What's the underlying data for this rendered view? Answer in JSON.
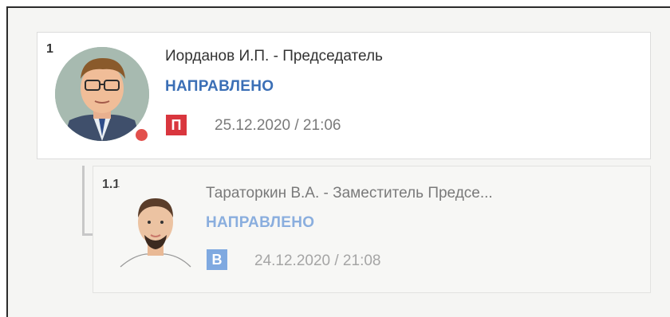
{
  "tree": {
    "nodes": [
      {
        "number": "1",
        "name": "Иорданов И.П. - Председатель",
        "status": "НАПРАВЛЕНО",
        "badge": "П",
        "datetime": "25.12.2020 / 21:06",
        "status_color": "#3b6fb6",
        "badge_color": "#d9363e",
        "online_dot_color": "#e2504c"
      },
      {
        "number": "1.1",
        "name": "Тараторкин В.А. - Заместитель Предсе...",
        "status": "НАПРАВЛЕНО",
        "badge": "В",
        "datetime": "24.12.2020 / 21:08",
        "status_color": "#8aaede",
        "badge_color": "#7fa9e0"
      }
    ]
  }
}
